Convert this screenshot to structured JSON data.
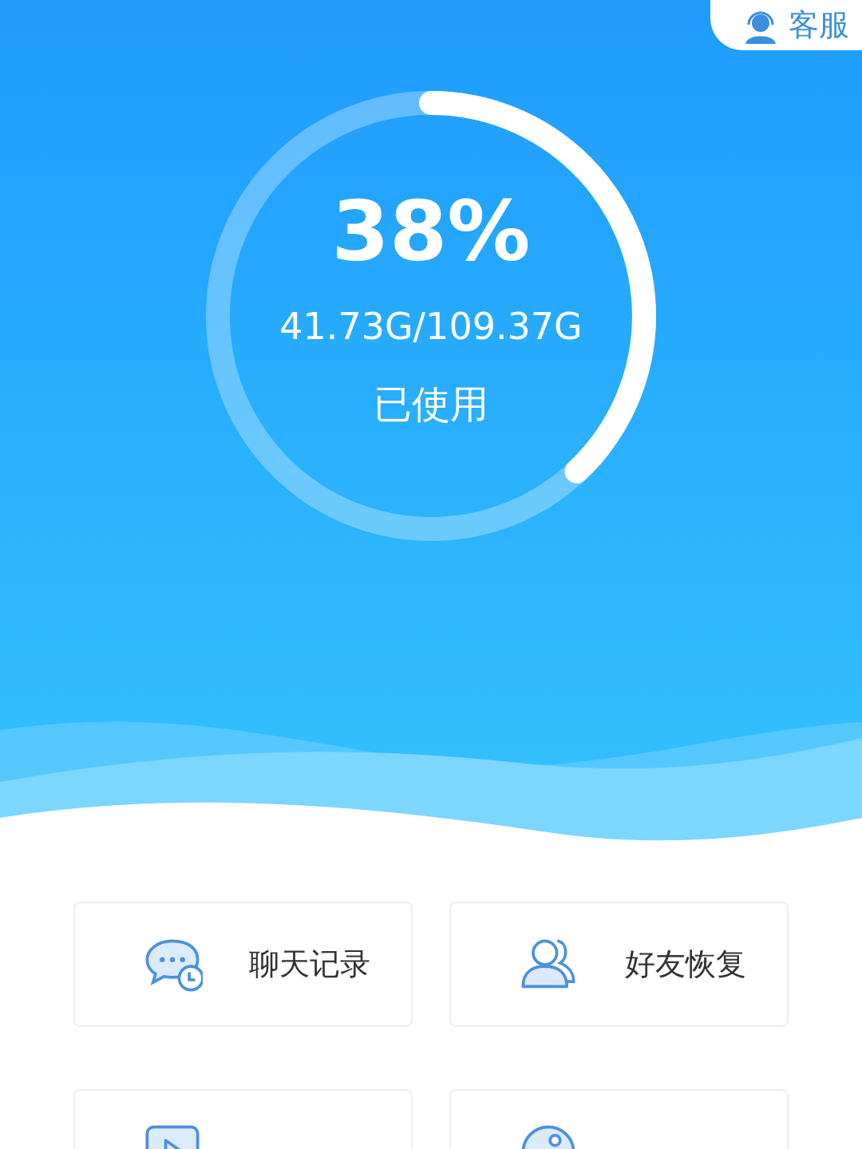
{
  "support_button": {
    "label": "客服"
  },
  "storage": {
    "percent": "38%",
    "level": 0.38,
    "usage": "41.73G/109.37G",
    "caption": "已使用"
  },
  "features": [
    {
      "kind": "chat",
      "label": "聊天记录"
    },
    {
      "kind": "friends",
      "label": "好友恢复"
    },
    {
      "kind": "video"
    },
    {
      "kind": "photo"
    }
  ]
}
